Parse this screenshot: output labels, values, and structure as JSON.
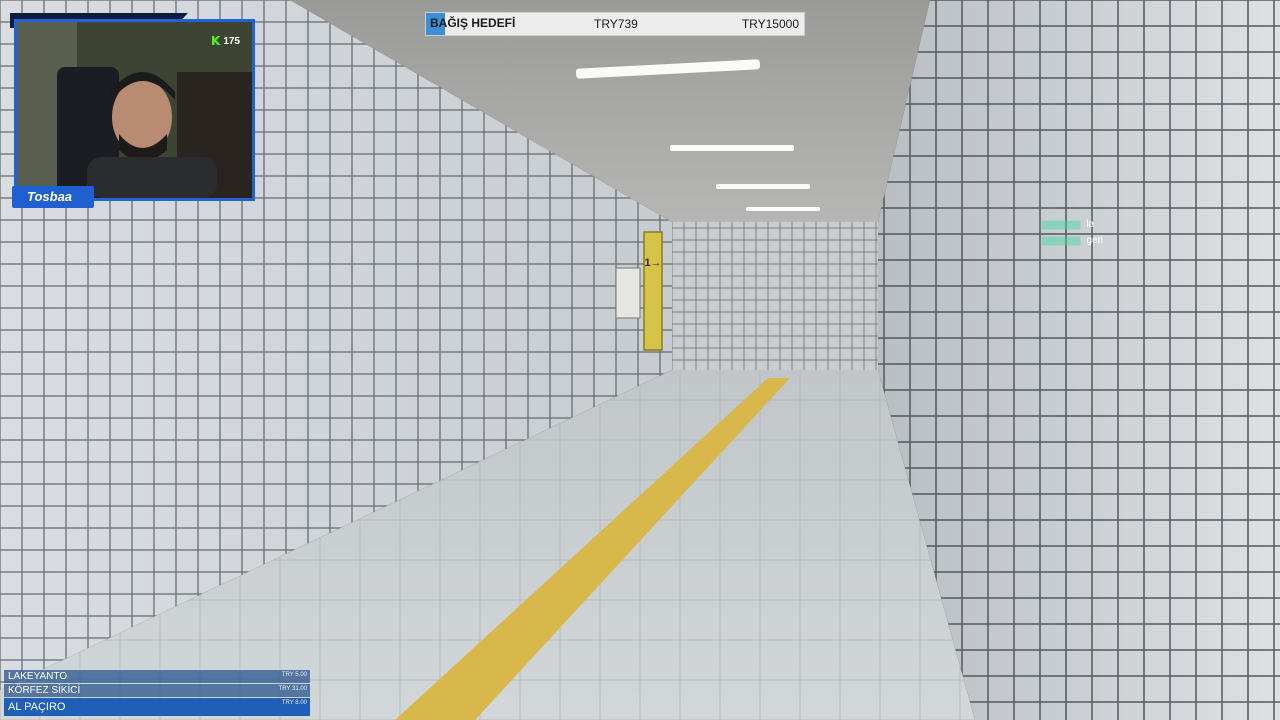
{
  "donation_goal": {
    "title": "BAĞIŞ HEDEFİ",
    "current": "TRY739",
    "target": "TRY15000",
    "progress": 0.049,
    "fill_color": "#3a8fd8"
  },
  "webcam": {
    "viewer_count": "175",
    "platform_icon": "kick-k-icon",
    "platform_glyph": "K",
    "platform_color": "#53fc18",
    "streamer_name": "Tosbaa",
    "frame_color": "#1f63d8"
  },
  "chat": {
    "messages": [
      {
        "user": "",
        "text": "la"
      },
      {
        "user": "",
        "text": "geri"
      }
    ]
  },
  "donations": {
    "items": [
      {
        "name": "LAKEYANTO",
        "amount": "TRY 5.00"
      },
      {
        "name": "KÖRFEZ SİKİCİ",
        "amount": "TRY 31.00"
      },
      {
        "name": "AL PAÇIRO",
        "amount": "TRY 8.00"
      }
    ]
  },
  "scene": {
    "sign_arrow": "1→",
    "tactile_strip_color": "#d8b84a",
    "tile_color": "#eef0f2",
    "grout_color": "#556066"
  }
}
